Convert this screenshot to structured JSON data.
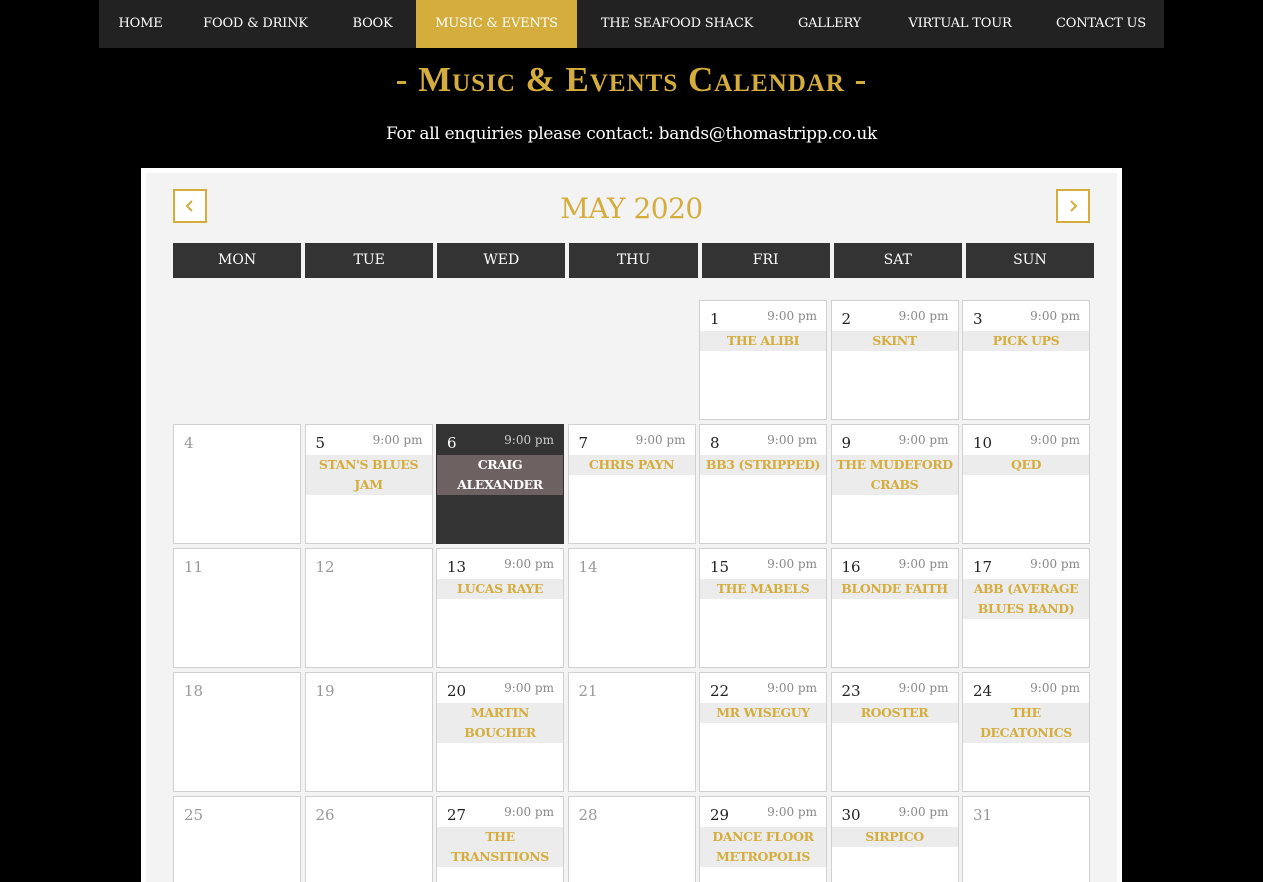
{
  "nav": {
    "items": [
      {
        "label": "HOME",
        "width": 83,
        "active": false
      },
      {
        "label": "FOOD & DRINK",
        "width": 147,
        "active": false
      },
      {
        "label": "BOOK",
        "width": 87,
        "active": false
      },
      {
        "label": "MUSIC & EVENTS",
        "width": 161,
        "active": true
      },
      {
        "label": "THE SEAFOOD SHACK",
        "width": 200,
        "active": false
      },
      {
        "label": "GALLERY",
        "width": 105,
        "active": false
      },
      {
        "label": "VIRTUAL TOUR",
        "width": 156,
        "active": false
      },
      {
        "label": "CONTACT US",
        "width": 126,
        "active": false
      }
    ]
  },
  "page_title": "- Music & Events Calendar -",
  "enquiries": "For all enquiries please contact: bands@thomastripp.co.uk",
  "calendar": {
    "month_label": "MAY 2020",
    "prev_icon": "chevron-left-icon",
    "next_icon": "chevron-right-icon",
    "accent_color": "#d4ad3d",
    "weekdays": [
      "MON",
      "TUE",
      "WED",
      "THU",
      "FRI",
      "SAT",
      "SUN"
    ],
    "leading_blanks": 4,
    "days": [
      {
        "day": "1",
        "time": "9:00 pm",
        "event": "THE ALIBI"
      },
      {
        "day": "2",
        "time": "9:00 pm",
        "event": "SKINT"
      },
      {
        "day": "3",
        "time": "9:00 pm",
        "event": "PICK UPS"
      },
      {
        "day": "4"
      },
      {
        "day": "5",
        "time": "9:00 pm",
        "event": "STAN'S BLUES JAM"
      },
      {
        "day": "6",
        "time": "9:00 pm",
        "event": "CRAIG ALEXANDER",
        "highlight": true
      },
      {
        "day": "7",
        "time": "9:00 pm",
        "event": "CHRIS PAYN"
      },
      {
        "day": "8",
        "time": "9:00 pm",
        "event": "BB3 (STRIPPED)"
      },
      {
        "day": "9",
        "time": "9:00 pm",
        "event": "THE MUDEFORD CRABS"
      },
      {
        "day": "10",
        "time": "9:00 pm",
        "event": "QED"
      },
      {
        "day": "11"
      },
      {
        "day": "12"
      },
      {
        "day": "13",
        "time": "9:00 pm",
        "event": "LUCAS RAYE"
      },
      {
        "day": "14"
      },
      {
        "day": "15",
        "time": "9:00 pm",
        "event": "THE MABELS"
      },
      {
        "day": "16",
        "time": "9:00 pm",
        "event": "BLONDE FAITH"
      },
      {
        "day": "17",
        "time": "9:00 pm",
        "event": "ABB (AVERAGE BLUES BAND)"
      },
      {
        "day": "18"
      },
      {
        "day": "19"
      },
      {
        "day": "20",
        "time": "9:00 pm",
        "event": "MARTIN BOUCHER"
      },
      {
        "day": "21"
      },
      {
        "day": "22",
        "time": "9:00 pm",
        "event": "MR WISEGUY"
      },
      {
        "day": "23",
        "time": "9:00 pm",
        "event": "ROOSTER"
      },
      {
        "day": "24",
        "time": "9:00 pm",
        "event": "THE DECATONICS"
      },
      {
        "day": "25"
      },
      {
        "day": "26"
      },
      {
        "day": "27",
        "time": "9:00 pm",
        "event": "THE TRANSITIONS"
      },
      {
        "day": "28"
      },
      {
        "day": "29",
        "time": "9:00 pm",
        "event": "DANCE FLOOR METROPOLIS"
      },
      {
        "day": "30",
        "time": "9:00 pm",
        "event": "SIRPICO"
      },
      {
        "day": "31"
      }
    ]
  }
}
